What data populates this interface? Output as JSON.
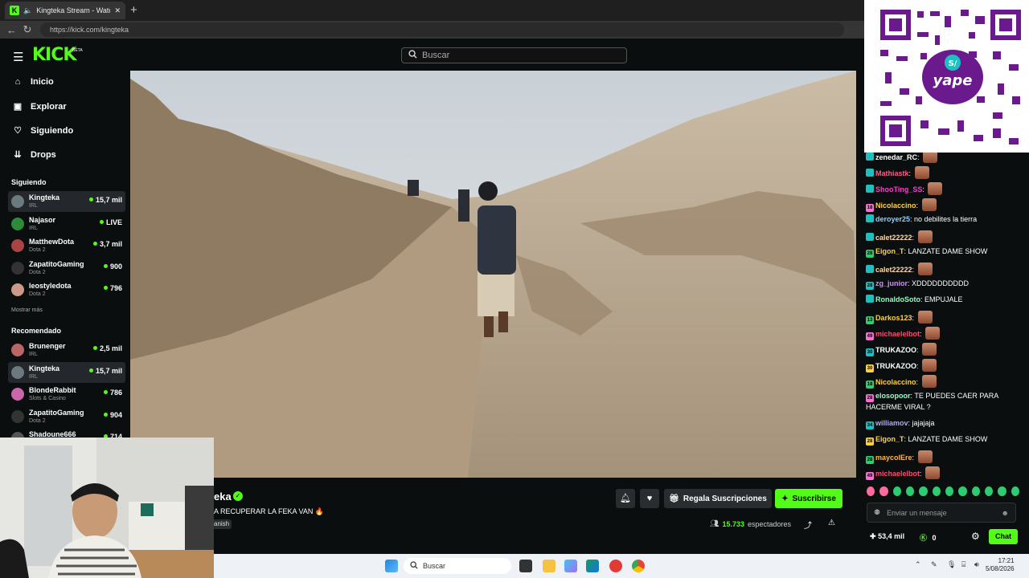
{
  "browser": {
    "tab_title": "Kingteka Stream - Watch Live",
    "tab_close": "✕",
    "new_tab": "+",
    "url": "https://kick.com/kingteka"
  },
  "header": {
    "logo": "KICK",
    "logo_badge": "BETA",
    "search_placeholder": "Buscar"
  },
  "sidebar": {
    "nav": [
      {
        "label": "Inicio",
        "icon": "home-icon"
      },
      {
        "label": "Explorar",
        "icon": "compass-icon"
      },
      {
        "label": "Siguiendo",
        "icon": "heart-icon"
      },
      {
        "label": "Drops",
        "icon": "drops-icon"
      }
    ],
    "following_title": "Siguiendo",
    "following": [
      {
        "name": "Kingteka",
        "category": "IRL",
        "viewers": "15,7 mil",
        "color": "#6b7a7e"
      },
      {
        "name": "Najasor",
        "category": "IRL",
        "viewers": "LIVE",
        "color": "#2c8a3a"
      },
      {
        "name": "MatthewDota",
        "category": "Dota 2",
        "viewers": "3,7 mil",
        "color": "#a44"
      },
      {
        "name": "ZapatitoGaming",
        "category": "Dota 2",
        "viewers": "900",
        "color": "#333"
      },
      {
        "name": "leostyledota",
        "category": "Dota 2",
        "viewers": "796",
        "color": "#c98"
      }
    ],
    "show_more": "Mostrar más",
    "recommended_title": "Recomendado",
    "recommended": [
      {
        "name": "Brunenger",
        "category": "IRL",
        "viewers": "2,5 mil",
        "color": "#b66"
      },
      {
        "name": "Kingteka",
        "category": "IRL",
        "viewers": "15,7 mil",
        "color": "#6b7a7e"
      },
      {
        "name": "BlondeRabbit",
        "category": "Slots & Casino",
        "viewers": "786",
        "color": "#c6a"
      },
      {
        "name": "ZapatitoGaming",
        "category": "Dota 2",
        "viewers": "904",
        "color": "#333"
      },
      {
        "name": "Shadoune666",
        "category": "",
        "viewers": "714",
        "color": "#555"
      }
    ]
  },
  "stream": {
    "streamer_name": "eka",
    "title": "A RECUPERAR LA FEKA VAN 🔥",
    "language": "anish",
    "viewers_count": "15.733",
    "viewers_label": "espectadores",
    "gift_label": "Regala Suscripciones",
    "subscribe_label": "Suscribirse"
  },
  "chat": {
    "messages": [
      {
        "badge": "",
        "user": "zenedar_RC",
        "text": "",
        "color": "#fff",
        "emote": true
      },
      {
        "badge": "",
        "user": "Mathiastk",
        "text": "",
        "color": "#ff5c8a",
        "emote": true
      },
      {
        "badge": "",
        "user": "ShooTing_SS",
        "text": "",
        "color": "#ff3bd1",
        "emote": true
      },
      {
        "badge": "18",
        "user": "Nicolaccino",
        "text": "",
        "color": "#ffd23c",
        "emote": true
      },
      {
        "badge": "",
        "user": "deroyer25",
        "text": "no debilites la tierra",
        "color": "#8fd0ff",
        "emote": false
      },
      {
        "badge": "",
        "user": "calet22222",
        "text": "",
        "color": "#ffd9a8",
        "emote": true
      },
      {
        "badge": "28",
        "user": "Eigon_T",
        "text": "LANZATE DAME SHOW",
        "color": "#ffd23c",
        "emote": false
      },
      {
        "badge": "",
        "user": "calet22222",
        "text": "",
        "color": "#ffd9a8",
        "emote": true
      },
      {
        "badge": "28",
        "user": "zg_junior",
        "text": "XDDDDDDDDDD",
        "color": "#d18cff",
        "emote": false
      },
      {
        "badge": "",
        "user": "RonaldoSoto",
        "text": "EMPUJALE",
        "color": "#8fffc0",
        "emote": false
      },
      {
        "badge": "13",
        "user": "Darkos123",
        "text": "",
        "color": "#ffd23c",
        "emote": true
      },
      {
        "badge": "49",
        "user": "michaelelbot",
        "text": "",
        "color": "#ff4b6e",
        "emote": true
      },
      {
        "badge": "30",
        "user": "TRUKAZOO",
        "text": "",
        "color": "#fff",
        "emote": true
      },
      {
        "badge": "30",
        "user": "TRUKAZOO",
        "text": "",
        "color": "#fff",
        "emote": true
      },
      {
        "badge": "18",
        "user": "Nicolaccino",
        "text": "",
        "color": "#ffd23c",
        "emote": true
      },
      {
        "badge": "28",
        "user": "elosopoor",
        "text": "TE PUEDES CAER PARA HACERME VIRAL ?",
        "color": "#8fffc0",
        "emote": false
      },
      {
        "badge": "34",
        "user": "williamov",
        "text": "jajajaja",
        "color": "#b3a6ff",
        "emote": false
      },
      {
        "badge": "28",
        "user": "Eigon_T",
        "text": "LANZATE DAME SHOW",
        "color": "#ffd23c",
        "emote": false
      },
      {
        "badge": "28",
        "user": "maycolEre",
        "text": "",
        "color": "#ffb84d",
        "emote": true
      },
      {
        "badge": "49",
        "user": "michaelelbot",
        "text": "",
        "color": "#ff4b6e",
        "emote": true
      }
    ],
    "input_placeholder": "Enviar un mensaje",
    "points": "53,4 mil",
    "coins": "0",
    "chat_button": "Chat"
  },
  "taskbar": {
    "search_placeholder": "Buscar",
    "time": "17:21",
    "date": "5/08/2026"
  },
  "qr": {
    "brand": "yape"
  }
}
